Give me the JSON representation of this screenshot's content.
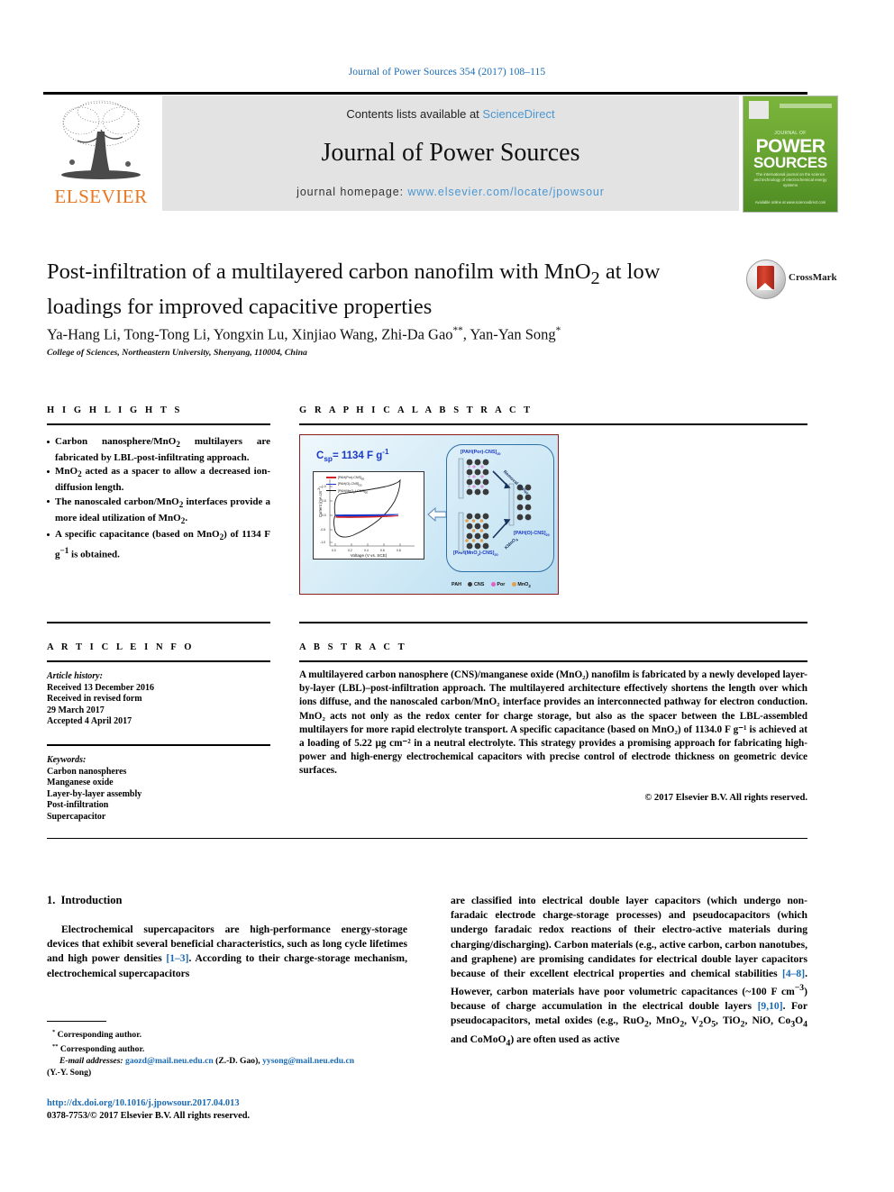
{
  "runhead": "Journal of Power Sources 354 (2017) 108–115",
  "masthead": {
    "contents_prefix": "Contents lists available at ",
    "sciencedirect": "ScienceDirect",
    "journal_title": "Journal of Power Sources",
    "homepage_label": "journal homepage: ",
    "homepage_url": "www.elsevier.com/locate/jpowsour",
    "publisher_logo_text": "ELSEVIER",
    "cover": {
      "small_top": "JOURNAL OF",
      "power": "POWER",
      "sources": "SOURCES",
      "subtitle": "The international journal on the science and technology of electrochemical energy systems",
      "footer": "Available online at www.sciencedirect.com"
    },
    "link_color": "#4a97d2",
    "elsevier_orange": "#E87722"
  },
  "article": {
    "title": "Post-infiltration of a multilayered carbon nanofilm with MnO₂ at low loadings for improved capacitive properties",
    "authors": "Ya-Hang Li, Tong-Tong Li, Yongxin Lu, Xinjiao Wang, Zhi-Da Gao, Yan-Yan Song",
    "affiliation": "College of Sciences, Northeastern University, Shenyang, 110004, China",
    "crossmark_label": "CrossMark"
  },
  "highlights": {
    "heading": "H I G H L I G H T S",
    "items": [
      "Carbon nanosphere/MnO₂ multilayers are fabricated by LBL-post-infiltrating approach.",
      "MnO₂ acted as a spacer to allow a decreased ion-diffusion length.",
      "The nanoscaled carbon/MnO₂ interfaces provide a more ideal utilization of MnO₂.",
      "A specific capacitance (based on MnO₂) of 1134 F g⁻¹ is obtained."
    ]
  },
  "graphical_abstract": {
    "heading": "G R A P H I C A L   A B S T R A C T",
    "csp_label": "C",
    "csp_sub": "sp",
    "csp_value": "= 1134 F g",
    "csp_sup": "-1",
    "plot": {
      "ylabel": "Current (mA cm⁻²)",
      "xlabel": "Voltage (V vs. SCE)",
      "legend": [
        {
          "name": "[PAH(Por)-CNS]₂₀",
          "color": "#d42027"
        },
        {
          "name": "[PAH(O)-CNS]₂₀",
          "color": "#1a39c8"
        },
        {
          "name": "[PAH(MnO₂)-CNS]₂₀",
          "color": "#111111"
        }
      ],
      "xticks": [
        "0.0",
        "0.2",
        "0.4",
        "0.6",
        "0.8"
      ],
      "yticks": [
        "1.0",
        "0.5",
        "0.0",
        "-0.5",
        "-1.0"
      ]
    },
    "labels": {
      "top": "[PAH(Por)-CNS]₂₀",
      "bottom": "[PAH(MnO₂)-CNS]₂₀",
      "right": "[PAH(O)-CNS]₂₀",
      "arrow_removal": "Removal of Por",
      "arrow_kmno4": "KMnO₄"
    },
    "key": [
      "PAH",
      "CNS",
      "Por",
      "MnO₂"
    ],
    "key_colors": {
      "cns": "#3a3a3a",
      "por": "#e061c8",
      "mno2": "#e0a050"
    },
    "border_color": "#8b1d1d"
  },
  "article_info": {
    "heading": "A R T I C L E   I N F O",
    "history_label": "Article history:",
    "history": [
      "Received 13 December 2016",
      "Received in revised form",
      "29 March 2017",
      "Accepted 4 April 2017"
    ],
    "keywords_label": "Keywords:",
    "keywords": [
      "Carbon nanospheres",
      "Manganese oxide",
      "Layer-by-layer assembly",
      "Post-infiltration",
      "Supercapacitor"
    ]
  },
  "abstract": {
    "heading": "A B S T R A C T",
    "text": "A multilayered carbon nanosphere (CNS)/manganese oxide (MnO₂) nanofilm is fabricated by a newly developed layer-by-layer (LBL)–post-infiltration approach. The multilayered architecture effectively shortens the length over which ions diffuse, and the nanoscaled carbon/MnO₂ interface provides an interconnected pathway for electron conduction. MnO₂ acts not only as the redox center for charge storage, but also as the spacer between the LBL-assembled multilayers for more rapid electrolyte transport. A specific capacitance (based on MnO₂) of 1134.0 F g⁻¹ is achieved at a loading of 5.22 µg cm⁻² in a neutral electrolyte. This strategy provides a promising approach for fabricating high-power and high-energy electrochemical capacitors with precise control of electrode thickness on geometric device surfaces.",
    "copyright": "© 2017 Elsevier B.V. All rights reserved."
  },
  "body": {
    "section_number": "1.",
    "section_title": "Introduction",
    "left_paragraph": "Electrochemical supercapacitors are high-performance energy-storage devices that exhibit several beneficial characteristics, such as long cycle lifetimes and high power densities [1–3]. According to their charge-storage mechanism, electrochemical supercapacitors",
    "left_ref": "[1–3]",
    "right_paragraph": "are classified into electrical double layer capacitors (which undergo non-faradaic electrode charge-storage processes) and pseudocapacitors (which undergo faradaic redox reactions of their electro-active materials during charging/discharging). Carbon materials (e.g., active carbon, carbon nanotubes, and graphene) are promising candidates for electrical double layer capacitors because of their excellent electrical properties and chemical stabilities [4–8]. However, carbon materials have poor volumetric capacitances (~100 F cm⁻³) because of charge accumulation in the electrical double layers [9,10]. For pseudocapacitors, metal oxides (e.g., RuO₂, MnO₂, V₂O₅, TiO₂, NiO, Co₃O₄ and CoMoO₄) are often used as active",
    "ref_48": "[4–8]",
    "ref_910": "[9,10]"
  },
  "footnotes": {
    "corr1": "Corresponding author.",
    "corr2": "Corresponding author.",
    "email_label": "E-mail addresses:",
    "email1": "gaozd@mail.neu.edu.cn",
    "email1_name": "(Z.-D. Gao)",
    "email2": "yysong@mail.neu.edu.cn",
    "email2_name": "(Y.-Y. Song)",
    "doi": "http://dx.doi.org/10.1016/j.jpowsour.2017.04.013",
    "issn_line": "0378-7753/© 2017 Elsevier B.V. All rights reserved."
  },
  "colors": {
    "link_blue": "#1a6bb5",
    "accent_blue": "#1a39c8",
    "red_border": "#8b1d1d",
    "cover_green": "#6aa632"
  }
}
